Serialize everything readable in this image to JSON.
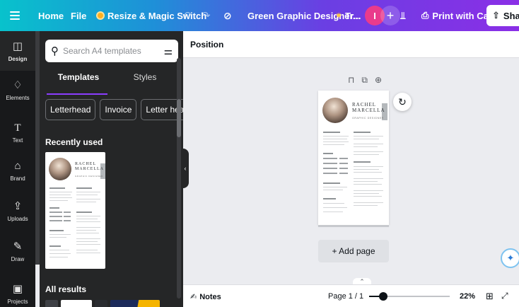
{
  "topbar": {
    "home": "Home",
    "file": "File",
    "resize": "Resize & Magic Switch",
    "doc_title": "Green Graphic Designer...",
    "tr": "Tr...",
    "avatar_initial": "I",
    "plus": "+",
    "print": "Print with Canva",
    "share": "Shar"
  },
  "rail": {
    "items": [
      {
        "label": "Design"
      },
      {
        "label": "Elements"
      },
      {
        "label": "Text"
      },
      {
        "label": "Brand"
      },
      {
        "label": "Uploads"
      },
      {
        "label": "Draw"
      },
      {
        "label": "Projects"
      }
    ]
  },
  "panel": {
    "search_placeholder": "Search A4 templates",
    "tabs": [
      "Templates",
      "Styles"
    ],
    "chips": [
      "Letterhead",
      "Invoice",
      "Letter head"
    ],
    "recently_used": "Recently used",
    "all_results": "All results"
  },
  "resume": {
    "first_name": "RACHEL",
    "last_name": "MARCELLA",
    "job": "GRAPHIC DESIGNER",
    "sections_left": [
      "ABOUT ME",
      "SKILLS",
      "LANGUAGES",
      "CONTACT"
    ],
    "sections_right": [
      "EDUCATION",
      "EXPERIENCE"
    ]
  },
  "canvas": {
    "position_label": "Position",
    "add_page": "+ Add page"
  },
  "bottombar": {
    "notes": "Notes",
    "page": "Page 1 / 1",
    "zoom": "22%",
    "zoom_fraction": 0.22
  },
  "colors": {
    "accent": "#8b3dff",
    "panel": "#252627",
    "rail": "#18191b",
    "canvas": "#ebecf0"
  }
}
